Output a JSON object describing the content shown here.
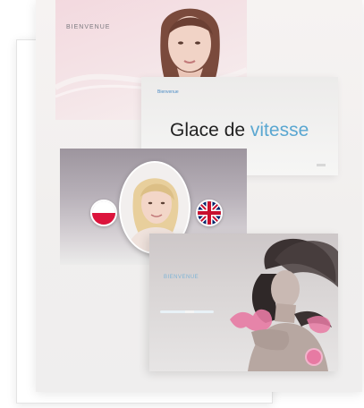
{
  "cards": {
    "card1": {
      "label": "BIENVENUE"
    },
    "card2": {
      "small_label": "Bienvenue",
      "headline_main": "Glace de ",
      "headline_accent": "vitesse"
    },
    "card3": {
      "flags": [
        "poland-flag-icon",
        "uk-flag-icon"
      ]
    },
    "card4": {
      "small_label": "BIENVENUE"
    }
  },
  "colors": {
    "accent_blue": "#5aa7d1",
    "pink": "#e77aa3",
    "pink_background": "#f3d9df"
  }
}
